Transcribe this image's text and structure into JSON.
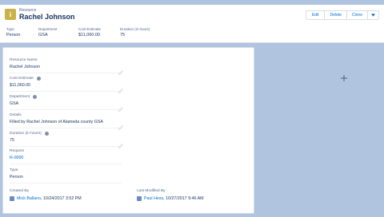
{
  "header": {
    "object_label": "Resource",
    "record_title": "Rachel Johnson",
    "actions": [
      "Edit",
      "Delete",
      "Clone"
    ],
    "highlights": [
      {
        "label": "Type",
        "value": "Person"
      },
      {
        "label": "Department",
        "value": "GSA"
      },
      {
        "label": "Cost Estimate",
        "value": "$11,060.00"
      },
      {
        "label": "Duration (in hours)",
        "value": "75"
      }
    ]
  },
  "details": {
    "resource_name": {
      "label": "Resource Name",
      "value": "Rachel Johnson"
    },
    "cost_estimate": {
      "label": "Cost Estimate",
      "value": "$11,060.00"
    },
    "department": {
      "label": "Department",
      "value": "GSA"
    },
    "details": {
      "label": "Details",
      "value": "Filled by Rachel Johnson of Alameda county GSA"
    },
    "duration": {
      "label": "Duration (in hours)",
      "value": "75"
    },
    "request": {
      "label": "Request",
      "value": "R-0000"
    },
    "type": {
      "label": "Type",
      "value": "Person"
    },
    "created_by": {
      "label": "Created By",
      "user": "Mick Ballano",
      "date": ", 10/24/2017 3:52 PM"
    },
    "last_modified_by": {
      "label": "Last Modified By",
      "user": "Paul Hess",
      "date": ", 10/27/2017 9:46 AM"
    }
  },
  "colors": {
    "background": "#b0c4df",
    "icon": "#c9b248",
    "link": "#0070d2",
    "text": "#16325c",
    "label": "#54698d"
  }
}
